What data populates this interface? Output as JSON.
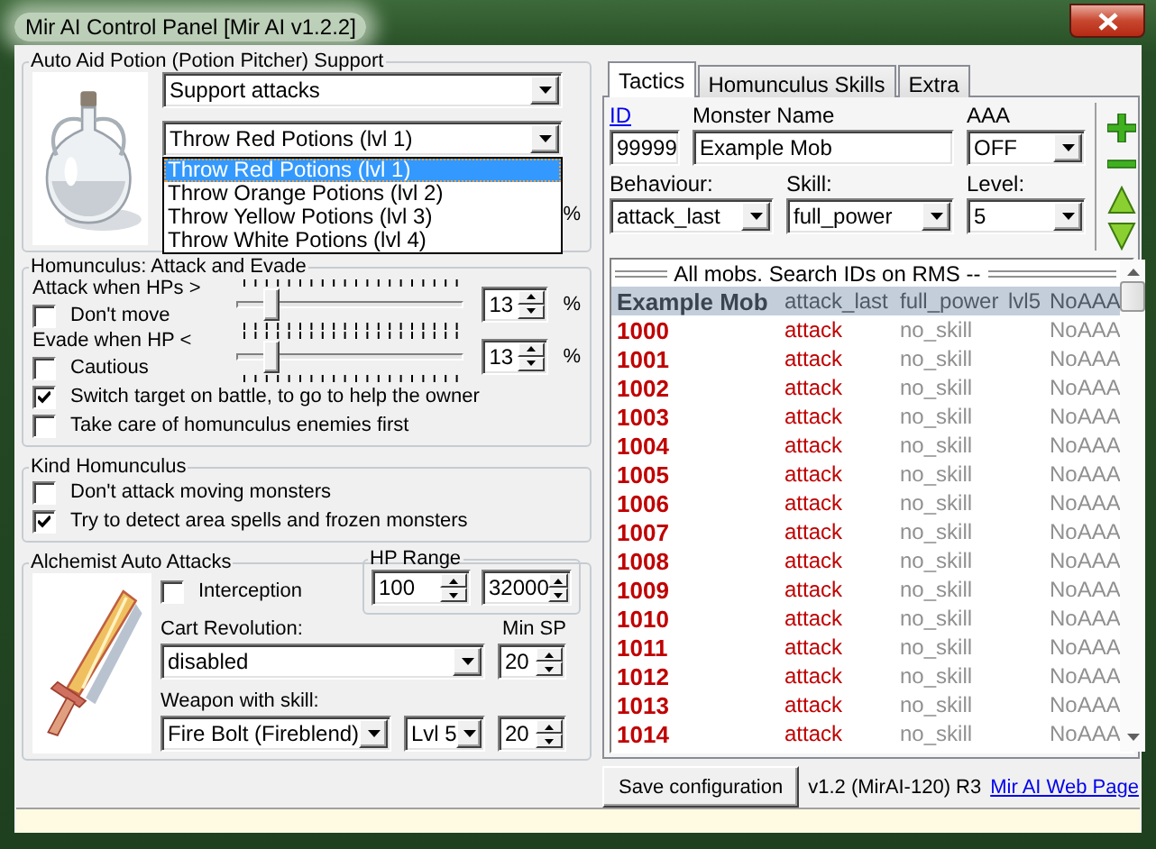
{
  "window": {
    "title": "Mir AI Control Panel [Mir AI v1.2.2]"
  },
  "potion_support": {
    "title": "Auto Aid Potion (Potion Pitcher) Support",
    "mode": "Support attacks",
    "potion": "Throw Red Potions (lvl 1)",
    "unit": "%",
    "options": [
      {
        "label": "Throw Red Potions (lvl 1)",
        "selected": true
      },
      {
        "label": "Throw Orange Potions (lvl 2)",
        "selected": false
      },
      {
        "label": "Throw Yellow Potions (lvl 3)",
        "selected": false
      },
      {
        "label": "Throw White Potions (lvl 4)",
        "selected": false
      }
    ]
  },
  "attack_evade": {
    "title": "Homunculus: Attack and Evade",
    "sliders": [
      {
        "label": "Attack when HPs >",
        "level": 0.13,
        "value": "13",
        "unit": "%",
        "option": {
          "label": "Don't move",
          "checked": false
        }
      },
      {
        "label": "Evade when HP <",
        "level": 0.13,
        "value": "13",
        "unit": "%",
        "option": {
          "label": "Cautious",
          "checked": false
        }
      }
    ],
    "options": [
      {
        "label": "Switch target on battle, to go to help the owner",
        "checked": true
      },
      {
        "label": "Take care of homunculus enemies first",
        "checked": false
      }
    ]
  },
  "kind_homunculus": {
    "title": "Kind Homunculus",
    "options": [
      {
        "label": "Don't attack moving monsters",
        "checked": false
      },
      {
        "label": "Try to detect area spells and frozen monsters",
        "checked": true
      }
    ]
  },
  "alchemist": {
    "title": "Alchemist Auto Attacks",
    "interception": {
      "label": "Interception",
      "checked": false
    },
    "hp_range": {
      "title": "HP Range",
      "min": "100",
      "max": "32000"
    },
    "cart_label": "Cart Revolution:",
    "cart_value": "disabled",
    "min_sp_label": "Min SP",
    "cart_min_sp": "20",
    "weapon_label": "Weapon with skill:",
    "weapon_skill": "Fire Bolt (Fireblend)",
    "weapon_level": "Lvl 5",
    "weapon_min_sp": "20"
  },
  "tabs": [
    {
      "label": "Tactics",
      "selected": true
    },
    {
      "label": "Homunculus Skills",
      "selected": false
    },
    {
      "label": "Extra",
      "selected": false
    }
  ],
  "monster_form": {
    "id_label": "ID",
    "id": "99999",
    "name_label": "Monster Name",
    "name": "Example Mob",
    "aaa_label": "AAA",
    "aaa": "OFF",
    "behaviour_label": "Behaviour:",
    "behaviour": "attack_last",
    "skill_label": "Skill:",
    "skill": "full_power",
    "level_label": "Level:",
    "level": "5"
  },
  "mob_list": {
    "heading": "All mobs. Search IDs on RMS --",
    "rows": [
      {
        "name": "Example Mob",
        "behaviour": "attack_last",
        "skill": "full_power",
        "level": "lvl5",
        "aaa": "NoAAA",
        "selected": true
      },
      {
        "name": "1000",
        "behaviour": "attack",
        "skill": "no_skill",
        "aaa": "NoAAA",
        "selected": false
      },
      {
        "name": "1001",
        "behaviour": "attack",
        "skill": "no_skill",
        "aaa": "NoAAA",
        "selected": false
      },
      {
        "name": "1002",
        "behaviour": "attack",
        "skill": "no_skill",
        "aaa": "NoAAA",
        "selected": false
      },
      {
        "name": "1003",
        "behaviour": "attack",
        "skill": "no_skill",
        "aaa": "NoAAA",
        "selected": false
      },
      {
        "name": "1004",
        "behaviour": "attack",
        "skill": "no_skill",
        "aaa": "NoAAA",
        "selected": false
      },
      {
        "name": "1005",
        "behaviour": "attack",
        "skill": "no_skill",
        "aaa": "NoAAA",
        "selected": false
      },
      {
        "name": "1006",
        "behaviour": "attack",
        "skill": "no_skill",
        "aaa": "NoAAA",
        "selected": false
      },
      {
        "name": "1007",
        "behaviour": "attack",
        "skill": "no_skill",
        "aaa": "NoAAA",
        "selected": false
      },
      {
        "name": "1008",
        "behaviour": "attack",
        "skill": "no_skill",
        "aaa": "NoAAA",
        "selected": false
      },
      {
        "name": "1009",
        "behaviour": "attack",
        "skill": "no_skill",
        "aaa": "NoAAA",
        "selected": false
      },
      {
        "name": "1010",
        "behaviour": "attack",
        "skill": "no_skill",
        "aaa": "NoAAA",
        "selected": false
      },
      {
        "name": "1011",
        "behaviour": "attack",
        "skill": "no_skill",
        "aaa": "NoAAA",
        "selected": false
      },
      {
        "name": "1012",
        "behaviour": "attack",
        "skill": "no_skill",
        "aaa": "NoAAA",
        "selected": false
      },
      {
        "name": "1013",
        "behaviour": "attack",
        "skill": "no_skill",
        "aaa": "NoAAA",
        "selected": false
      },
      {
        "name": "1014",
        "behaviour": "attack",
        "skill": "no_skill",
        "aaa": "NoAAA",
        "selected": false
      }
    ]
  },
  "footer": {
    "save_button": "Save configuration",
    "version": "v1.2 (MirAI-120) R3",
    "link": "Mir AI Web Page"
  }
}
